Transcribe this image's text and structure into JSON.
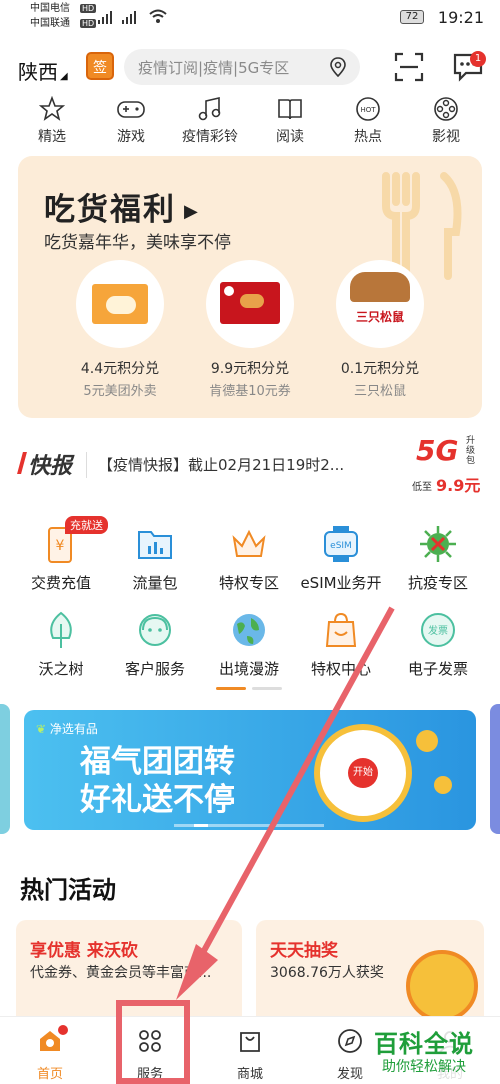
{
  "status_bar": {
    "carrier1": "中国电信",
    "carrier2": "中国联通",
    "battery": "72",
    "time": "19:21"
  },
  "header": {
    "location": "陕西",
    "sign_label": "签",
    "search_placeholder": "疫情订阅|疫情|5G专区",
    "message_badge": "1"
  },
  "quick_nav": [
    {
      "label": "精选",
      "icon": "star-icon"
    },
    {
      "label": "游戏",
      "icon": "gamepad-icon"
    },
    {
      "label": "疫情彩铃",
      "icon": "music-note-icon"
    },
    {
      "label": "阅读",
      "icon": "book-icon"
    },
    {
      "label": "热点",
      "icon": "hot-icon",
      "badge": "HOT"
    },
    {
      "label": "影视",
      "icon": "film-reel-icon"
    }
  ],
  "banner": {
    "title": "吃货福利",
    "subtitle": "吃货嘉年华，美味享不停",
    "products": [
      {
        "price": "4.4元积分兑",
        "desc": "5元美团外卖"
      },
      {
        "price": "9.9元积分兑",
        "desc": "肯德基10元券"
      },
      {
        "price": "0.1元积分兑",
        "desc": "三只松鼠",
        "logo": "三只松鼠"
      }
    ]
  },
  "news": {
    "label": "快报",
    "text": "【疫情快报】截止02月21日19时2...",
    "ad_5g": "5G",
    "ad_upgrade": "升级包",
    "ad_price_prefix": "低至",
    "ad_price": "9.9元"
  },
  "services": [
    {
      "label": "交费充值",
      "badge": "充就送",
      "icon": "phone-charge-icon"
    },
    {
      "label": "流量包",
      "icon": "folder-chart-icon"
    },
    {
      "label": "特权专区",
      "icon": "crown-icon"
    },
    {
      "label": "eSIM业务开",
      "icon": "esim-watch-icon",
      "icon_text": "eSIM"
    },
    {
      "label": "抗疫专区",
      "icon": "virus-icon"
    },
    {
      "label": "沃之树",
      "icon": "tree-icon"
    },
    {
      "label": "客户服务",
      "icon": "customer-service-icon"
    },
    {
      "label": "出境漫游",
      "icon": "globe-icon"
    },
    {
      "label": "特权中心",
      "icon": "shopping-bag-icon"
    },
    {
      "label": "电子发票",
      "icon": "invoice-icon",
      "icon_text": "发票"
    }
  ],
  "promo": {
    "brand": "净选有品",
    "line1": "福气团团转",
    "line2": "好礼送不停",
    "wheel_label": "开始"
  },
  "hot": {
    "title": "热门活动",
    "cards": [
      {
        "title": "享优惠 来沃砍",
        "desc": "代金券、黄金会员等丰富商..."
      },
      {
        "title": "天天抽奖",
        "desc": "3068.76万人获奖"
      }
    ]
  },
  "tabbar": [
    {
      "label": "首页",
      "icon": "home-icon"
    },
    {
      "label": "服务",
      "icon": "grid-icon"
    },
    {
      "label": "商城",
      "icon": "shopping-bag-icon"
    },
    {
      "label": "发现",
      "icon": "compass-icon"
    },
    {
      "label": "我的",
      "icon": "user-icon"
    }
  ],
  "watermark": {
    "title": "百科全说",
    "subtitle": "助你轻松解决"
  },
  "colors": {
    "accent": "#e5322d",
    "orange": "#f08a24",
    "annotation": "#e8636a",
    "banner_bg": "#fcecd8"
  }
}
